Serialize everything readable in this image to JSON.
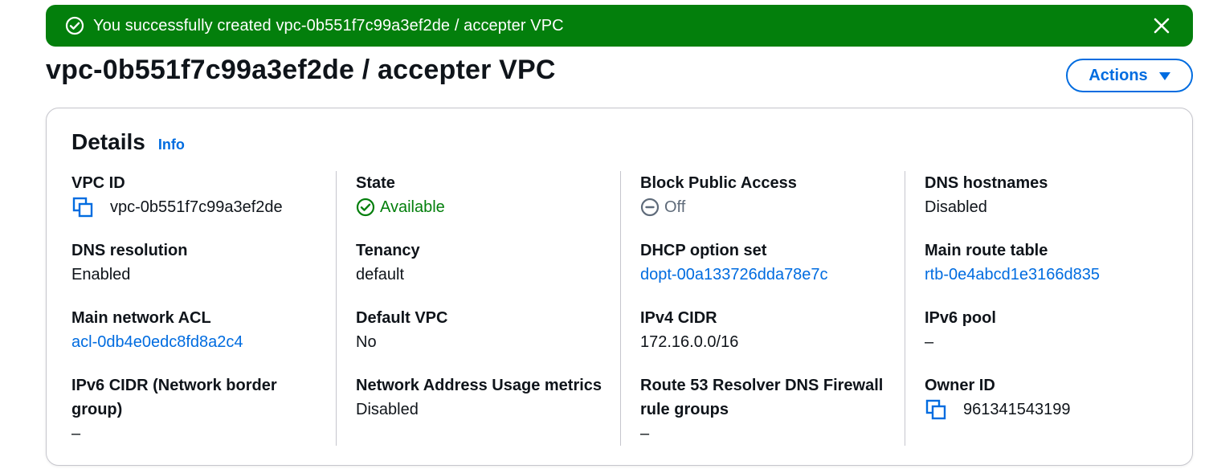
{
  "flash": {
    "message": "You successfully created vpc-0b551f7c99a3ef2de / accepter VPC",
    "status_color": "#037f0c"
  },
  "header": {
    "title": "vpc-0b551f7c99a3ef2de / accepter VPC",
    "actions_label": "Actions"
  },
  "details": {
    "title": "Details",
    "info_label": "Info",
    "columns": [
      [
        {
          "label": "VPC ID",
          "value": "vpc-0b551f7c99a3ef2de",
          "icon": "copy-icon"
        },
        {
          "label": "DNS resolution",
          "value": "Enabled"
        },
        {
          "label": "Main network ACL",
          "value": "acl-0db4e0edc8fd8a2c4",
          "link": true
        },
        {
          "label": "IPv6 CIDR (Network border group)",
          "value": "–"
        }
      ],
      [
        {
          "label": "State",
          "value": "Available",
          "icon": "check-circle-icon",
          "color": "#037f0c"
        },
        {
          "label": "Tenancy",
          "value": "default"
        },
        {
          "label": "Default VPC",
          "value": "No"
        },
        {
          "label": "Network Address Usage metrics",
          "value": "Disabled"
        }
      ],
      [
        {
          "label": "Block Public Access",
          "value": "Off",
          "icon": "minus-circle-icon",
          "color": "#5f6b7a"
        },
        {
          "label": "DHCP option set",
          "value": "dopt-00a133726dda78e7c",
          "link": true
        },
        {
          "label": "IPv4 CIDR",
          "value": "172.16.0.0/16"
        },
        {
          "label": "Route 53 Resolver DNS Firewall rule groups",
          "value": "–"
        }
      ],
      [
        {
          "label": "DNS hostnames",
          "value": "Disabled"
        },
        {
          "label": "Main route table",
          "value": "rtb-0e4abcd1e3166d835",
          "link": true
        },
        {
          "label": "IPv6 pool",
          "value": "–"
        },
        {
          "label": "Owner ID",
          "value": "961341543199",
          "icon": "copy-icon"
        }
      ]
    ]
  },
  "colors": {
    "link": "#006ce0",
    "success": "#037f0c",
    "muted": "#5f6b7a"
  }
}
